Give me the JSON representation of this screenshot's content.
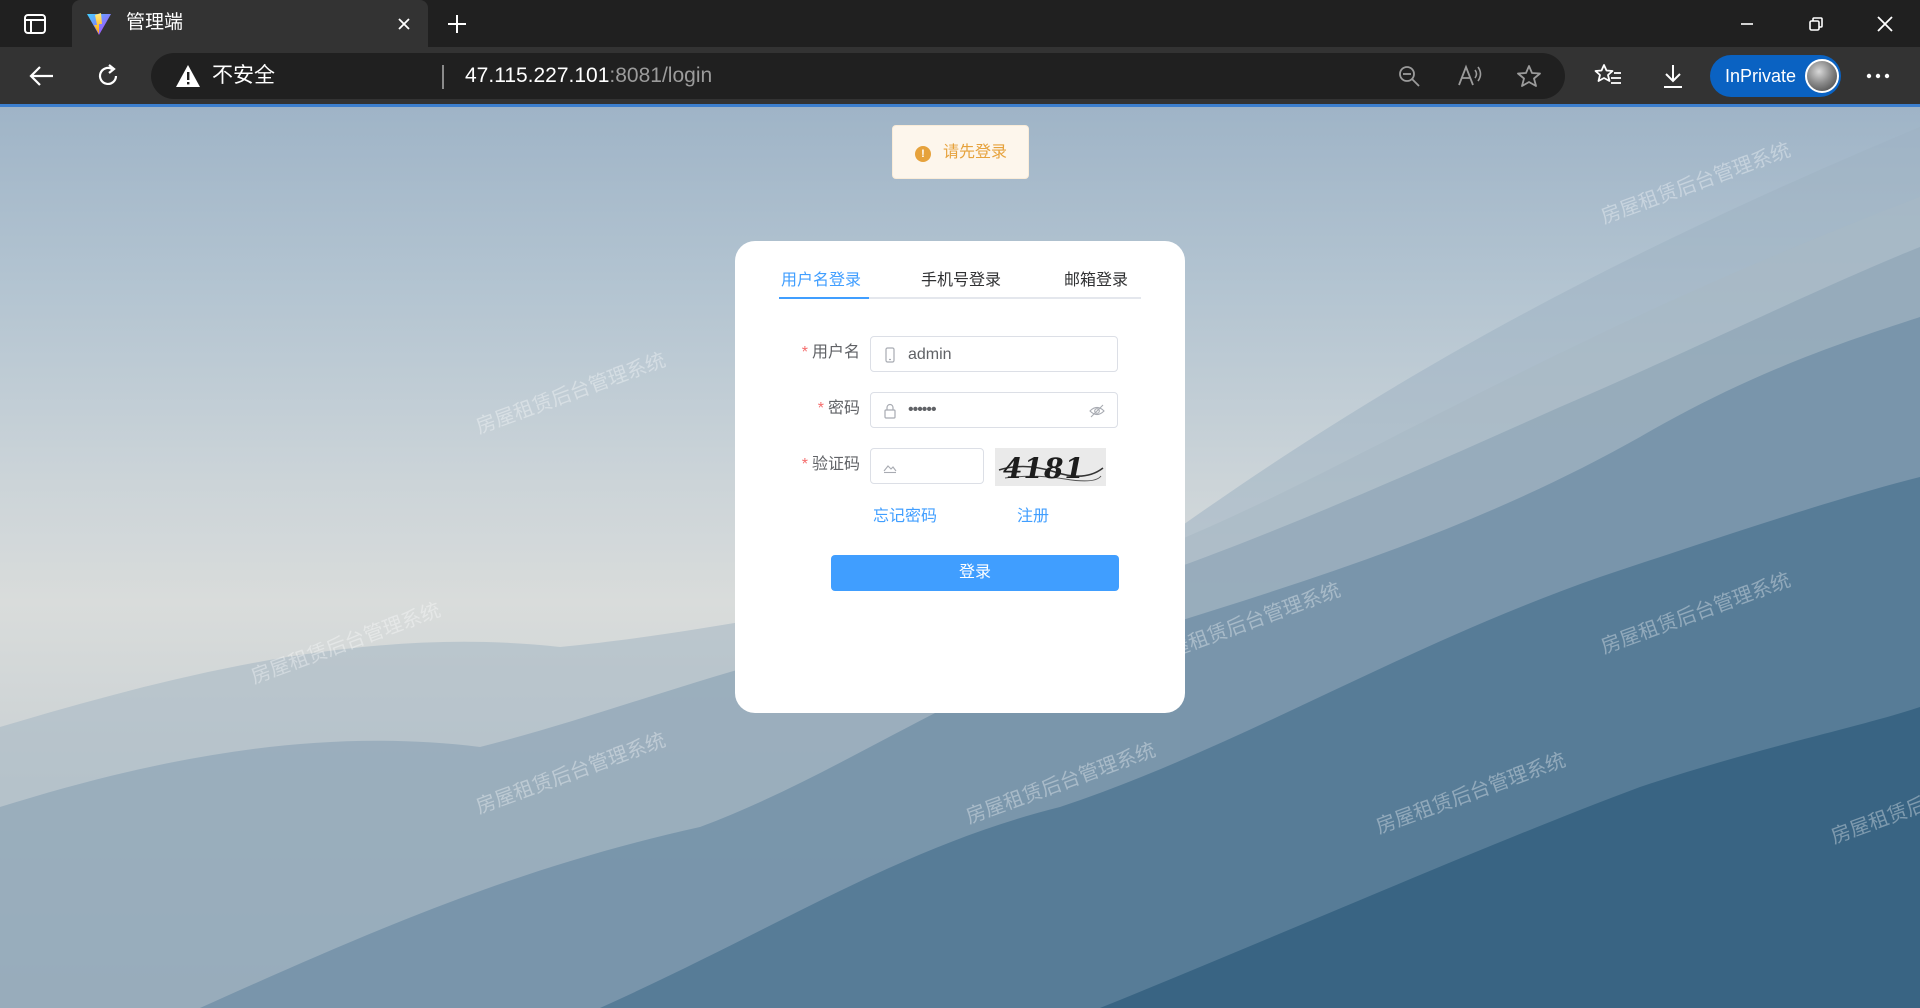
{
  "browser": {
    "tab": {
      "title": "管理端"
    },
    "address": {
      "security_label": "不安全",
      "url_host": "47.115.227.101",
      "url_rest": ":8081/login"
    },
    "inprivate_label": "InPrivate"
  },
  "toast": {
    "icon": "!",
    "message": "请先登录"
  },
  "login": {
    "tabs": [
      {
        "label": "用户名登录",
        "active": true
      },
      {
        "label": "手机号登录",
        "active": false
      },
      {
        "label": "邮箱登录",
        "active": false
      }
    ],
    "required_mark": "*",
    "username": {
      "label": "用户名",
      "value": "admin"
    },
    "password": {
      "label": "密码",
      "value": "••••••"
    },
    "captcha": {
      "label": "验证码",
      "value": "",
      "image_text": "4181"
    },
    "forgot_link": "忘记密码",
    "register_link": "注册",
    "submit_label": "登录"
  },
  "watermark_text": "房屋租赁后台管理系统",
  "colors": {
    "primary": "#409eff",
    "warning": "#e6a23c",
    "danger": "#f56c6c",
    "browser_dark": "#202020",
    "inprivate": "#0a62c2"
  }
}
